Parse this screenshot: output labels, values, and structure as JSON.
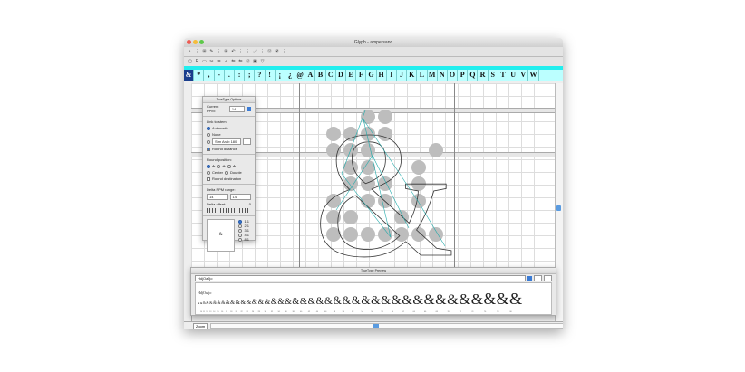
{
  "window": {
    "title": "Glyph - ampersand"
  },
  "toolbar1": [
    "↖",
    "⋮",
    "⊞",
    "✎",
    "⋮",
    "⊞",
    "↶",
    "⋮",
    "⋮",
    "⤢",
    "⋮",
    "⊡",
    "⊠",
    "⋮"
  ],
  "toolbar2": [
    "▢",
    "R",
    "▭",
    "✂",
    "⇋",
    "✓",
    "⇋",
    "⇋",
    "⊡",
    "▣",
    "▽"
  ],
  "glyph_strip": [
    "&",
    "*",
    ",",
    "-",
    ".",
    ":",
    ";",
    "?",
    "!",
    "¡",
    "¿",
    "@",
    "A",
    "B",
    "C",
    "D",
    "E",
    "F",
    "G",
    "H",
    "I",
    "J",
    "K",
    "L",
    "M",
    "N",
    "O",
    "P",
    "Q",
    "R",
    "S",
    "T",
    "U",
    "V",
    "W"
  ],
  "glyph_canvas": {
    "glyph": "&"
  },
  "tt_options": {
    "title": "TrueType Options",
    "ppm_label": "Current PPM:",
    "ppm_value": "14",
    "link_label": "Link to stem:",
    "automatic": "Automatic",
    "none": "None",
    "stem_value": "Stm Arab 180",
    "round_distance": "Round distance",
    "round_position": "Round position:",
    "center": "Center",
    "double": "Double",
    "round_destination": "Round destination",
    "delta_range": "Delta PPM range:",
    "delta_from": "14",
    "delta_to": "14",
    "delta_offset": "Delta offset:",
    "delta_offset_value": "0",
    "scales": [
      "1:1",
      "2:1",
      "3:1",
      "4:1",
      "8:1"
    ]
  },
  "preview": {
    "title": "TrueType Preview",
    "text": "HdjOaJjo",
    "sample_small": "HdjOaJjo",
    "glyph": "&",
    "sizes": [
      9,
      10,
      11,
      12,
      13,
      14,
      15,
      16,
      17,
      18,
      20,
      22,
      24,
      26,
      28,
      30,
      32,
      34,
      36,
      38,
      40,
      42,
      44,
      46,
      48,
      50,
      52,
      54,
      56,
      58,
      60,
      62,
      64,
      66,
      68,
      70,
      72,
      74,
      76,
      78,
      80
    ]
  },
  "bottombar": {
    "zoom": "Zoom"
  }
}
